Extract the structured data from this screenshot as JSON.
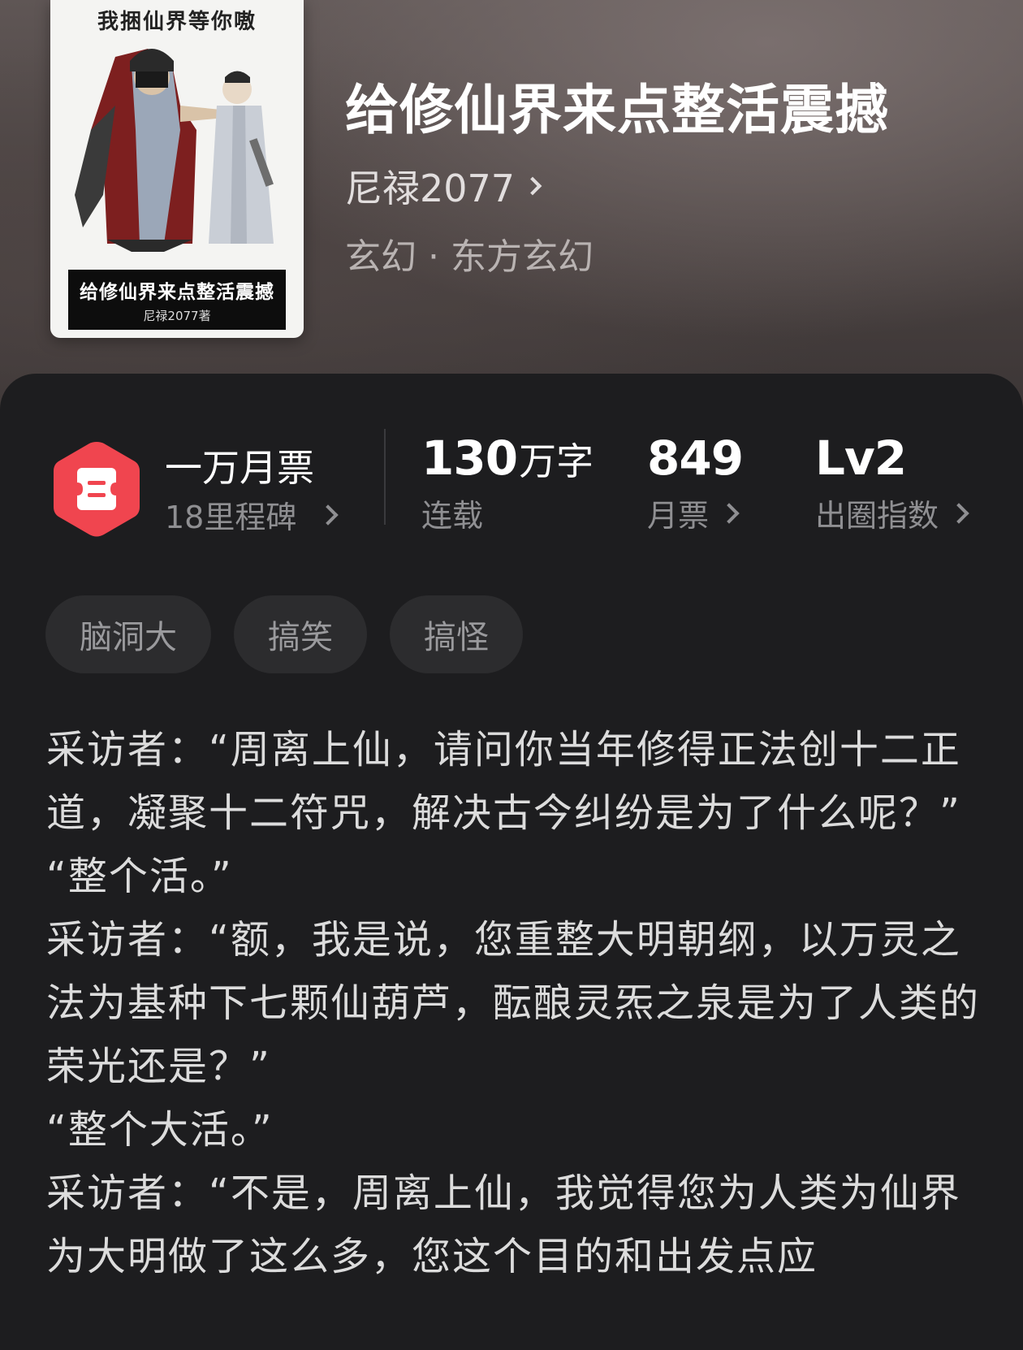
{
  "book": {
    "title": "给修仙界来点整活震撼",
    "author": "尼禄2077",
    "genre": "玄幻 · 东方玄幻",
    "cover": {
      "top_text": "我捆仙界等你嗷",
      "banner_title": "给修仙界来点整活震撼",
      "banner_author": "尼禄2077著"
    }
  },
  "stats": {
    "ticket_title": "一万月票",
    "ticket_sub": "18里程碑",
    "words_value": "130",
    "words_unit": "万字",
    "words_label": "连载",
    "votes_value": "849",
    "votes_label": "月票",
    "level_value": "Lv2",
    "level_label": "出圈指数"
  },
  "tags": [
    "脑洞大",
    "搞笑",
    "搞怪"
  ],
  "synopsis": [
    "采访者：“周离上仙，请问你当年修得正法创十二正道，凝聚十二符咒，解决古今纠纷是为了什么呢？”",
    "“整个活。”",
    "采访者：“额，我是说，您重整大明朝纲，以万灵之法为基种下七颗仙葫芦，酝酿灵炁之泉是为了人类的荣光还是？”",
    "“整个大活。”",
    "采访者：“不是，周离上仙，我觉得您为人类为仙界为大明做了这么多，您这个目的和出发点应"
  ],
  "colors": {
    "accent_red": "#f0454f",
    "panel_bg": "#1d1d1f",
    "tag_bg": "#2c2c2e"
  }
}
